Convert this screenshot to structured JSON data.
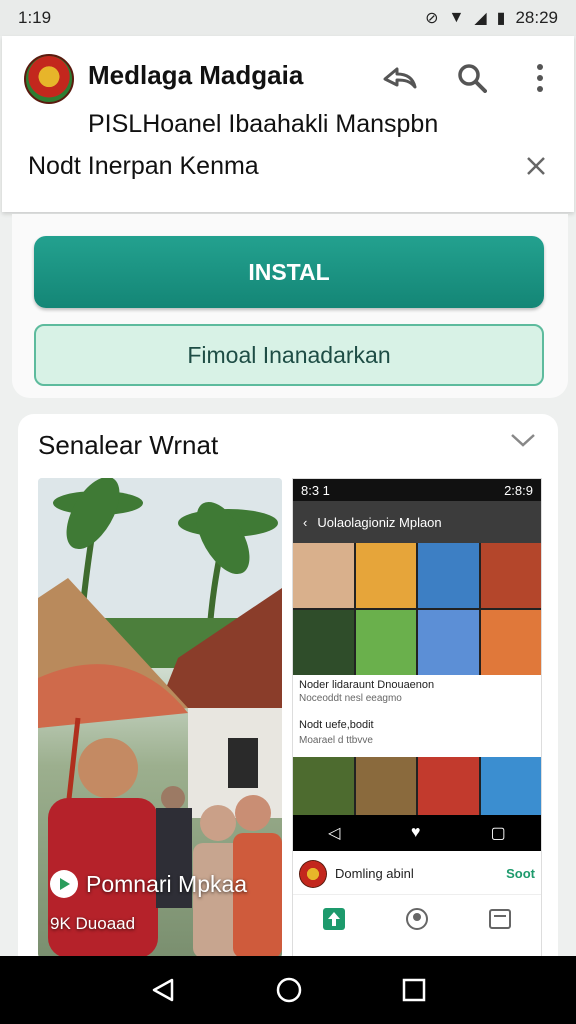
{
  "status_bar": {
    "time": "1:19",
    "clock": "28:29"
  },
  "app_bar": {
    "title": "Medlaga Madgaia",
    "subtitle": "PISLHoanel Ibaahakli Manspbn",
    "notice": "Nodt Inerpan Kenma",
    "icons": [
      "share-icon",
      "search-icon",
      "more-icon",
      "close-icon"
    ]
  },
  "actions": {
    "install_label": "INSTAL",
    "secondary_label": "Fimoal Inanadarkan",
    "accent_color": "#148676"
  },
  "gallery": {
    "title": "Senalear Wrnat",
    "screenshot1": {
      "label": "Pomnari Mpkaa",
      "sublabel": "9K Duoaad"
    },
    "screenshot2": {
      "status_time": "8:3 1",
      "status_right": "2:8:9",
      "header": "Uolaolagioniz Mplaon",
      "caption1": "Noder lidaraunt Dnouaenon",
      "caption1_sub": "Noceoddt nesl eeagmo",
      "row2_title": "Nodt uefe,bodit",
      "row2_sub": "Moarael d ttbvve",
      "app_name": "Domling abinl",
      "app_action": "Soot"
    }
  }
}
